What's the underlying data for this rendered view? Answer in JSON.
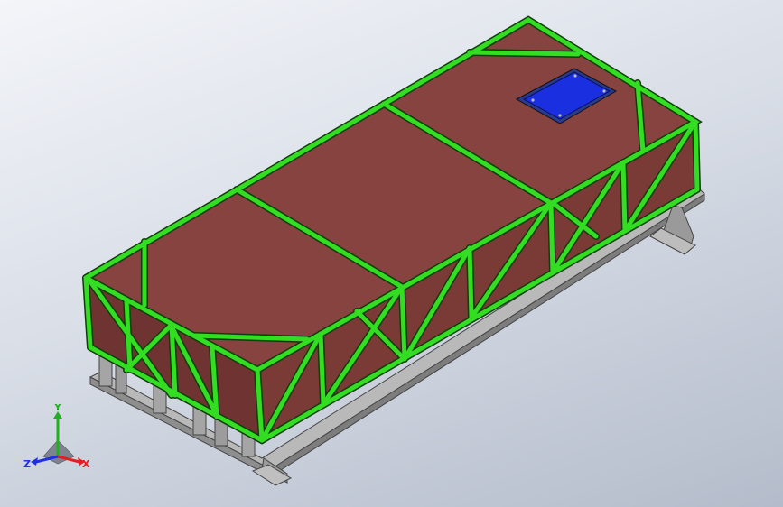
{
  "viewport": {
    "background_top": "#f3f5f9",
    "background_bottom": "#b4bccb"
  },
  "model": {
    "frame_color": "#33dd22",
    "frame_edge_color": "#0f3d0a",
    "panel_color": "#86433f",
    "panel_dark_color": "#6f3432",
    "base_color": "#a9a9a9",
    "hatch_color": "#1a2fe0"
  },
  "triad": {
    "x_label": "X",
    "y_label": "Y",
    "z_label": "Z",
    "x_color": "#e02020",
    "y_color": "#20b020",
    "z_color": "#2030e0"
  }
}
